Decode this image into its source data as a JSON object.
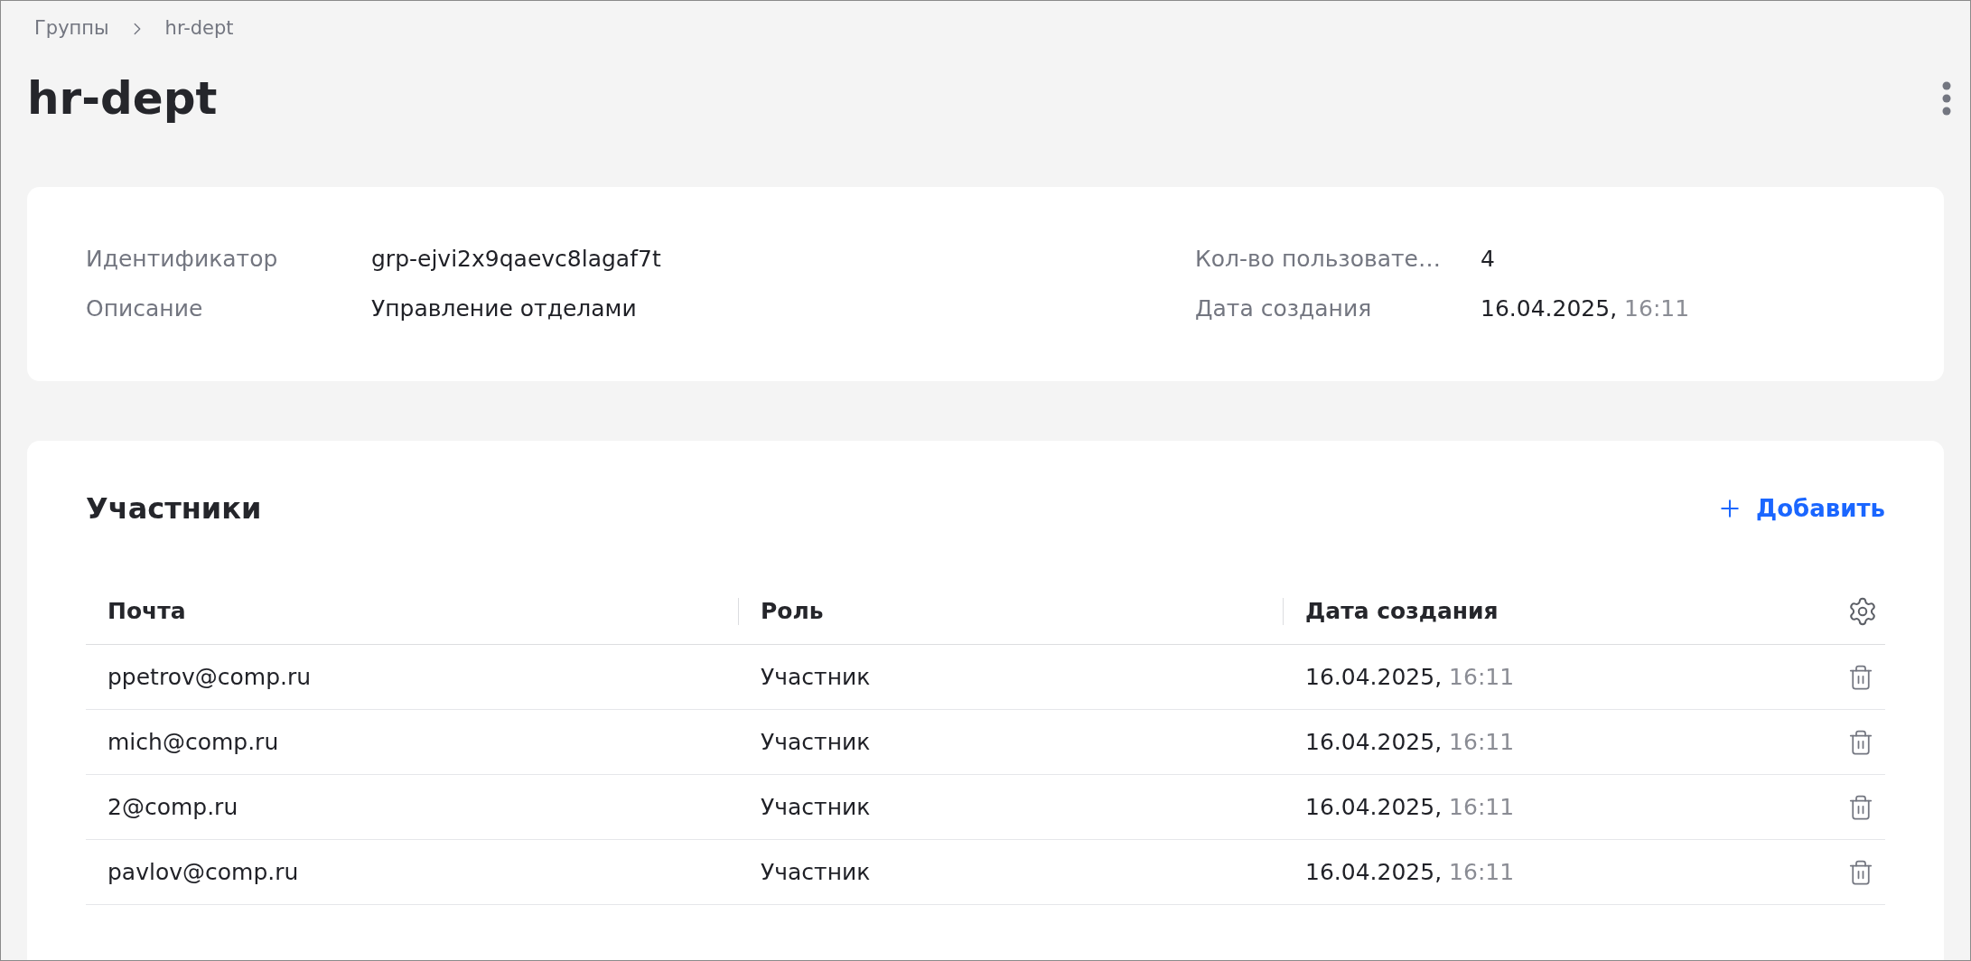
{
  "breadcrumbs": [
    {
      "label": "Группы"
    },
    {
      "label": "hr-dept"
    }
  ],
  "title": "hr-dept",
  "info": {
    "left": [
      {
        "label": "Идентификатор",
        "value": "grp-ejvi2x9qaevc8lagaf7t"
      },
      {
        "label": "Описание",
        "value": "Управление отделами"
      }
    ],
    "right": [
      {
        "label": "Кол-во пользовате…",
        "value": "4"
      },
      {
        "label": "Дата создания",
        "date": "16.04.2025,",
        "time": "16:11"
      }
    ]
  },
  "members": {
    "title": "Участники",
    "add_button": "Добавить",
    "columns": [
      "Почта",
      "Роль",
      "Дата создания"
    ],
    "rows": [
      {
        "email": "ppetrov@comp.ru",
        "role": "Участник",
        "date": "16.04.2025,",
        "time": "16:11"
      },
      {
        "email": "mich@comp.ru",
        "role": "Участник",
        "date": "16.04.2025,",
        "time": "16:11"
      },
      {
        "email": "2@comp.ru",
        "role": "Участник",
        "date": "16.04.2025,",
        "time": "16:11"
      },
      {
        "email": "pavlov@comp.ru",
        "role": "Участник",
        "date": "16.04.2025,",
        "time": "16:11"
      }
    ]
  }
}
